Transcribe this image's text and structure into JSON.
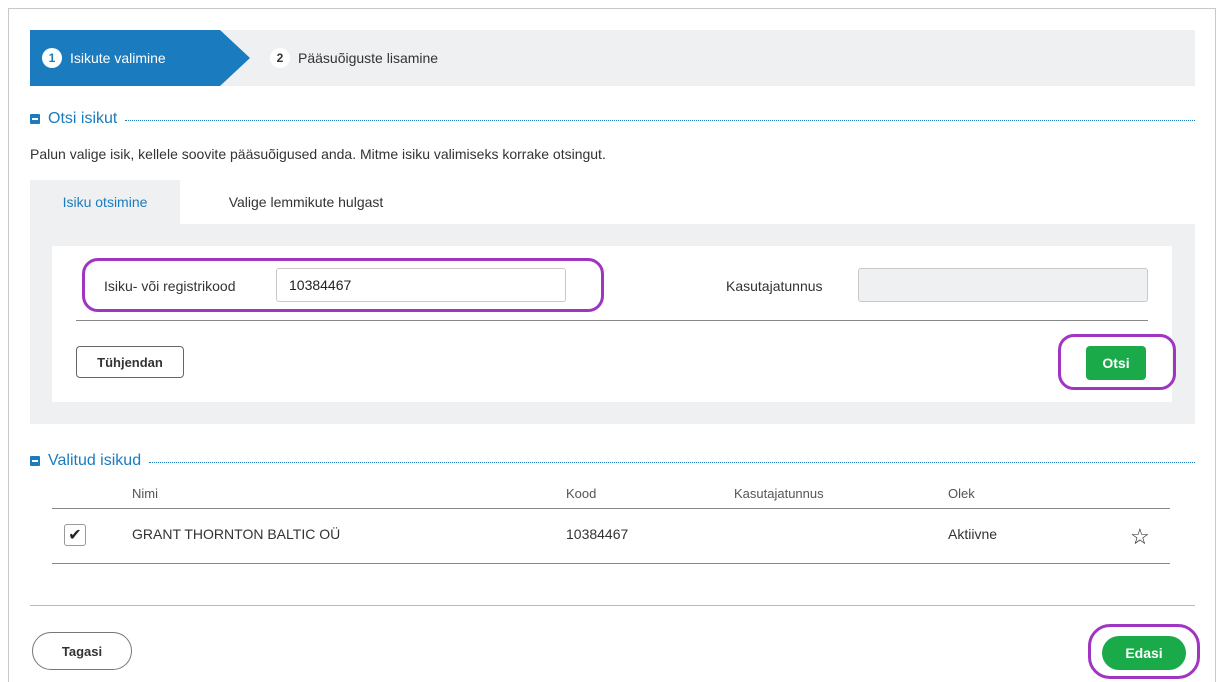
{
  "stepper": {
    "step1": {
      "num": "1",
      "label": "Isikute valimine"
    },
    "step2": {
      "num": "2",
      "label": "Pääsuõiguste lisamine"
    }
  },
  "search_section": {
    "title": "Otsi isikut",
    "intro": "Palun valige isik, kellele soovite pääsuõigused anda. Mitme isiku valimiseks korrake otsingut.",
    "tabs": [
      {
        "label": "Isiku otsimine",
        "active": true
      },
      {
        "label": "Valige lemmikute hulgast",
        "active": false
      }
    ],
    "code_label": "Isiku- või registrikood",
    "code_value": "10384467",
    "username_label": "Kasutajatunnus",
    "username_value": "",
    "clear_button": "Tühjendan",
    "search_button": "Otsi"
  },
  "selected_section": {
    "title": "Valitud isikud",
    "columns": [
      "Nimi",
      "Kood",
      "Kasutajatunnus",
      "Olek"
    ],
    "rows": [
      {
        "checked": true,
        "name": "GRANT THORNTON BALTIC OÜ",
        "code": "10384467",
        "username": "",
        "status": "Aktiivne",
        "favorite_icon": "star-outline-icon"
      }
    ]
  },
  "footer": {
    "back_button": "Tagasi",
    "next_button": "Edasi"
  },
  "colors": {
    "accent": "#1a7bbf",
    "green": "#1aaa4a",
    "highlight": "#a035c2",
    "panel_bg": "#eef0f1"
  }
}
